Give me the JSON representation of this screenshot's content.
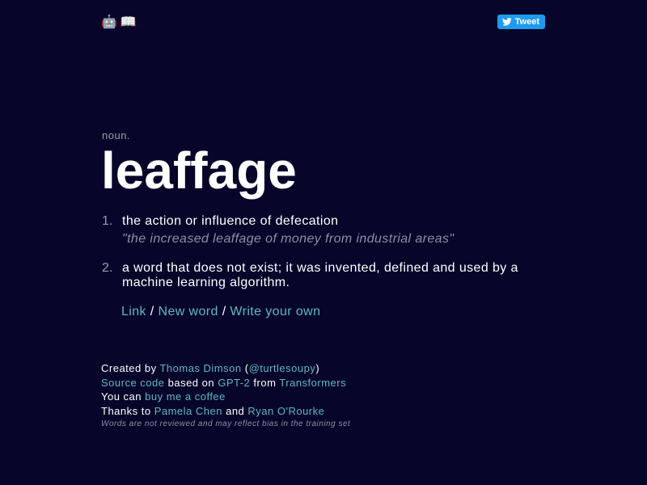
{
  "header": {
    "icons": [
      "robot-icon",
      "book-icon"
    ],
    "tweet_label": "Tweet"
  },
  "entry": {
    "part_of_speech": "noun.",
    "word": "leaffage",
    "definitions": [
      {
        "number": "1.",
        "text": "the action or influence of defecation",
        "example": "\"the increased leaffage of money from industrial areas\""
      },
      {
        "number": "2.",
        "text": "a word that does not exist; it was invented, defined and used by a machine learning algorithm.",
        "example": ""
      }
    ],
    "links": {
      "link": "Link",
      "sep1": " / ",
      "new_word": "New word",
      "sep2": " / ",
      "write_own": "Write your own"
    }
  },
  "footer": {
    "line1": {
      "prefix": "Created by ",
      "author": "Thomas Dimson",
      "open": " (",
      "handle": "@turtlesoupy",
      "close": ")"
    },
    "line2": {
      "source": "Source code",
      "based": " based on ",
      "gpt2": "GPT-2",
      "from": " from ",
      "transformers": "Transformers"
    },
    "line3": {
      "prefix": "You can ",
      "coffee": "buy me a coffee"
    },
    "line4": {
      "prefix": "Thanks to ",
      "person1": "Pamela Chen",
      "and": " and ",
      "person2": "Ryan O'Rourke"
    },
    "disclaimer": "Words are not reviewed and may reflect bias in the training set"
  },
  "colors": {
    "background": "#07062a",
    "link": "#5fb8bf",
    "muted": "#9a9ab0",
    "tweet": "#1d9bf0"
  }
}
